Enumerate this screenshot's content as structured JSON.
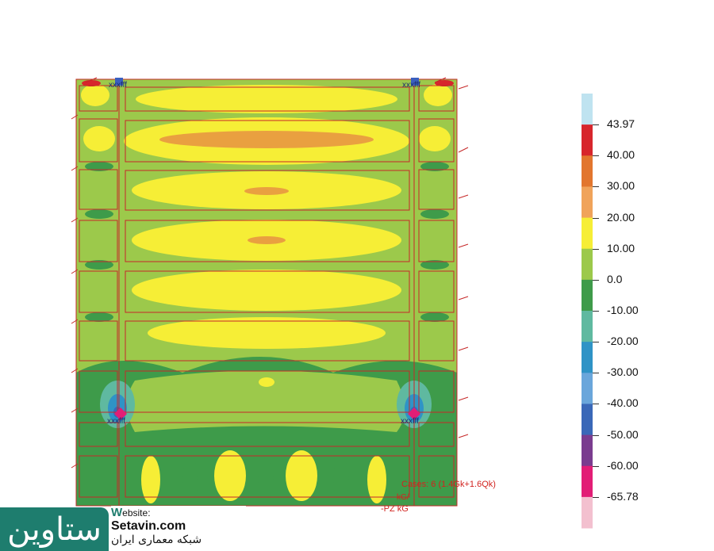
{
  "legend": {
    "colors": [
      "#bfe3f0",
      "#d7262c",
      "#e2762e",
      "#f0a35a",
      "#f6ee36",
      "#9cc94b",
      "#3e9b4a",
      "#5fb9a0",
      "#2f93c6",
      "#6aa6db",
      "#3a68b8",
      "#7a3c8f",
      "#e21d76",
      "#f3c0cf"
    ],
    "labels": [
      "43.97",
      "40.00",
      "30.00",
      "20.00",
      "10.00",
      "0.0",
      "-10.00",
      "-20.00",
      "-30.00",
      "-40.00",
      "-50.00",
      "-60.00",
      "-65.78"
    ]
  },
  "plot": {
    "node_labels": [
      "xxxfff",
      "xxxfff",
      "xxxfff",
      "xxxfff"
    ],
    "cases": "Cases: 6 (1.4Gk+1.6Qk)",
    "cases_sub": "kG/",
    "units": "-PZ  kG"
  },
  "logo": {
    "brand": "ستاوین",
    "website_label_initial": "W",
    "website_label_rest": "ebsite:",
    "domain": "Setavin.com",
    "persian_tagline": "شبکه معماری ایران"
  }
}
